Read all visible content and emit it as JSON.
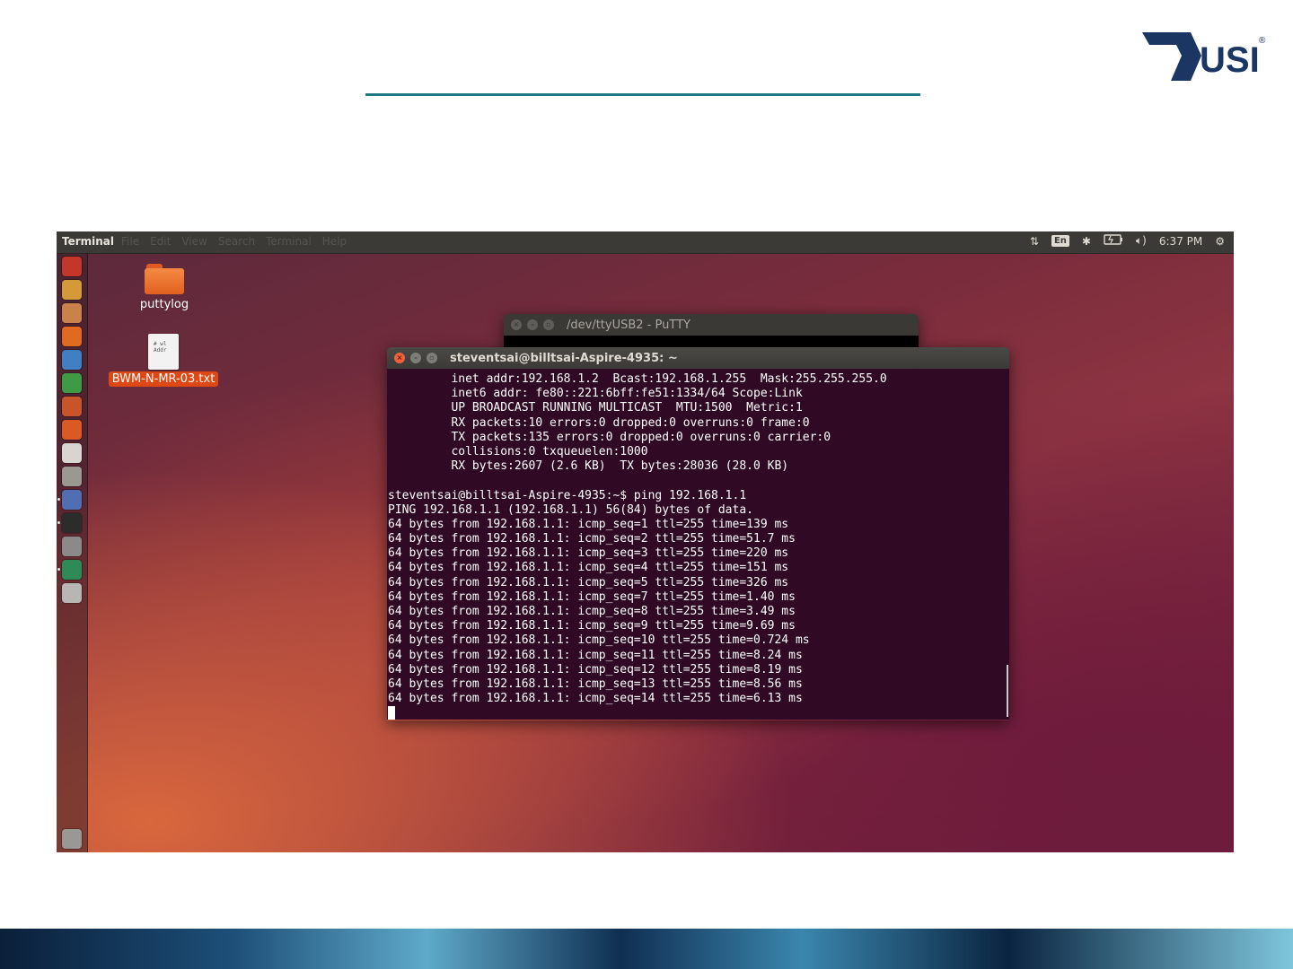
{
  "panel": {
    "app_title": "Terminal",
    "menu": [
      "File",
      "Edit",
      "View",
      "Search",
      "Terminal",
      "Help"
    ],
    "keyboard_layout": "En",
    "clock": "6:37 PM"
  },
  "desktop_icons": [
    {
      "label": "puttylog"
    },
    {
      "label": "BWM-N-MR-03.txt",
      "preview": "# wl\nAddr"
    }
  ],
  "windows": {
    "putty": {
      "title": "/dev/ttyUSB2 - PuTTY"
    },
    "terminal": {
      "title": "steventsai@billtsai-Aspire-4935: ~",
      "lines": [
        "         inet addr:192.168.1.2  Bcast:192.168.1.255  Mask:255.255.255.0",
        "         inet6 addr: fe80::221:6bff:fe51:1334/64 Scope:Link",
        "         UP BROADCAST RUNNING MULTICAST  MTU:1500  Metric:1",
        "         RX packets:10 errors:0 dropped:0 overruns:0 frame:0",
        "         TX packets:135 errors:0 dropped:0 overruns:0 carrier:0",
        "         collisions:0 txqueuelen:1000",
        "         RX bytes:2607 (2.6 KB)  TX bytes:28036 (28.0 KB)",
        "",
        "steventsai@billtsai-Aspire-4935:~$ ping 192.168.1.1",
        "PING 192.168.1.1 (192.168.1.1) 56(84) bytes of data.",
        "64 bytes from 192.168.1.1: icmp_seq=1 ttl=255 time=139 ms",
        "64 bytes from 192.168.1.1: icmp_seq=2 ttl=255 time=51.7 ms",
        "64 bytes from 192.168.1.1: icmp_seq=3 ttl=255 time=220 ms",
        "64 bytes from 192.168.1.1: icmp_seq=4 ttl=255 time=151 ms",
        "64 bytes from 192.168.1.1: icmp_seq=5 ttl=255 time=326 ms",
        "64 bytes from 192.168.1.1: icmp_seq=7 ttl=255 time=1.40 ms",
        "64 bytes from 192.168.1.1: icmp_seq=8 ttl=255 time=3.49 ms",
        "64 bytes from 192.168.1.1: icmp_seq=9 ttl=255 time=9.69 ms",
        "64 bytes from 192.168.1.1: icmp_seq=10 ttl=255 time=0.724 ms",
        "64 bytes from 192.168.1.1: icmp_seq=11 ttl=255 time=8.24 ms",
        "64 bytes from 192.168.1.1: icmp_seq=12 ttl=255 time=8.19 ms",
        "64 bytes from 192.168.1.1: icmp_seq=13 ttl=255 time=8.56 ms",
        "64 bytes from 192.168.1.1: icmp_seq=14 ttl=255 time=6.13 ms"
      ]
    }
  },
  "launcher": {
    "icons": [
      {
        "name": "dash-home-icon",
        "color": "#c2372a"
      },
      {
        "name": "software-updater-icon",
        "color": "#d49a3a"
      },
      {
        "name": "files-icon",
        "color": "#c9834a"
      },
      {
        "name": "firefox-icon",
        "color": "#e06a1f"
      },
      {
        "name": "libreoffice-writer-icon",
        "color": "#3f7fc2"
      },
      {
        "name": "libreoffice-calc-icon",
        "color": "#3f9a45"
      },
      {
        "name": "libreoffice-impress-icon",
        "color": "#c8542a"
      },
      {
        "name": "ubuntu-software-center-icon",
        "color": "#d95a23"
      },
      {
        "name": "amazon-icon",
        "color": "#d8d4cf"
      },
      {
        "name": "system-settings-icon",
        "color": "#9b9892"
      },
      {
        "name": "network-tool-icon",
        "color": "#4f6fb2"
      },
      {
        "name": "terminal-icon",
        "color": "#2c2c2c"
      },
      {
        "name": "screenshot-icon",
        "color": "#8c8a86"
      },
      {
        "name": "software-properties-icon",
        "color": "#2e8b57"
      },
      {
        "name": "drive-icon",
        "color": "#b8b6b2"
      }
    ],
    "trash": {
      "name": "trash-icon",
      "color": "#9a9894"
    }
  },
  "brand": {
    "logo_text": "USI",
    "logo_color": "#1b3663",
    "accent": "#1f7a86"
  }
}
